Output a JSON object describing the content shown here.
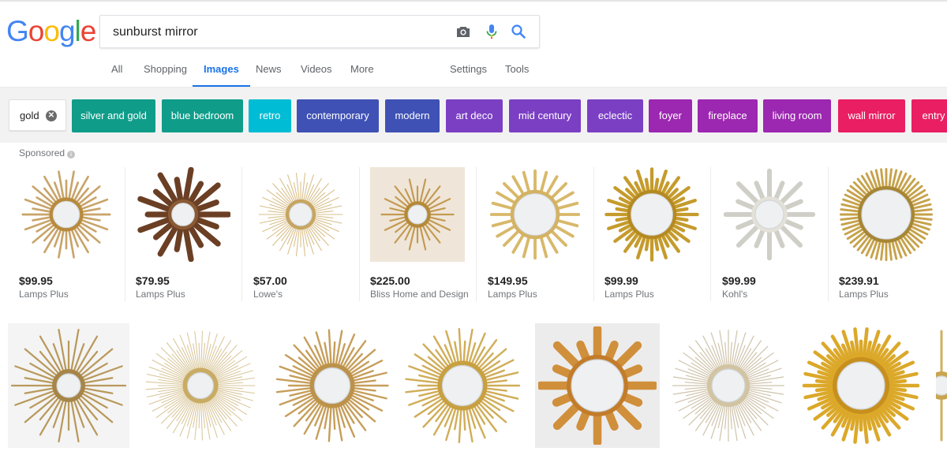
{
  "logo": [
    "G",
    "o",
    "o",
    "g",
    "l",
    "e"
  ],
  "logo_colors": [
    "#4285f4",
    "#ea4335",
    "#fbbc05",
    "#4285f4",
    "#34a853",
    "#ea4335"
  ],
  "search": {
    "query": "sunburst mirror"
  },
  "icons": [
    "camera-icon",
    "microphone-icon",
    "search-icon",
    "close-icon",
    "info-icon"
  ],
  "tabs": [
    {
      "label": "All"
    },
    {
      "label": "Shopping"
    },
    {
      "label": "Images",
      "active": true
    },
    {
      "label": "News"
    },
    {
      "label": "Videos"
    },
    {
      "label": "More"
    },
    {
      "label": "Settings"
    },
    {
      "label": "Tools"
    }
  ],
  "chips": [
    {
      "label": "gold",
      "color": "#ffffff"
    },
    {
      "label": "silver and gold",
      "color": "#0f9d8a"
    },
    {
      "label": "blue bedroom",
      "color": "#0f9d8a"
    },
    {
      "label": "retro",
      "color": "#00bcd4"
    },
    {
      "label": "contemporary",
      "color": "#3f51b5"
    },
    {
      "label": "modern",
      "color": "#3f51b5"
    },
    {
      "label": "art deco",
      "color": "#7b3fc4"
    },
    {
      "label": "mid century",
      "color": "#7b3fc4"
    },
    {
      "label": "eclectic",
      "color": "#7b3fc4"
    },
    {
      "label": "foyer",
      "color": "#9c27b0"
    },
    {
      "label": "fireplace",
      "color": "#9c27b0"
    },
    {
      "label": "living room",
      "color": "#9c27b0"
    },
    {
      "label": "wall mirror",
      "color": "#e91e63"
    },
    {
      "label": "entry",
      "color": "#e91e63"
    }
  ],
  "sponsored_label": "Sponsored",
  "products": [
    {
      "price": "$99.95",
      "store": "Lamps Plus"
    },
    {
      "price": "$79.95",
      "store": "Lamps Plus"
    },
    {
      "price": "$57.00",
      "store": "Lowe's"
    },
    {
      "price": "$225.00",
      "store": "Bliss Home and Design"
    },
    {
      "price": "$149.95",
      "store": "Lamps Plus"
    },
    {
      "price": "$99.99",
      "store": "Lamps Plus"
    },
    {
      "price": "$99.99",
      "store": "Kohl's"
    },
    {
      "price": "$239.91",
      "store": "Lamps Plus"
    }
  ]
}
